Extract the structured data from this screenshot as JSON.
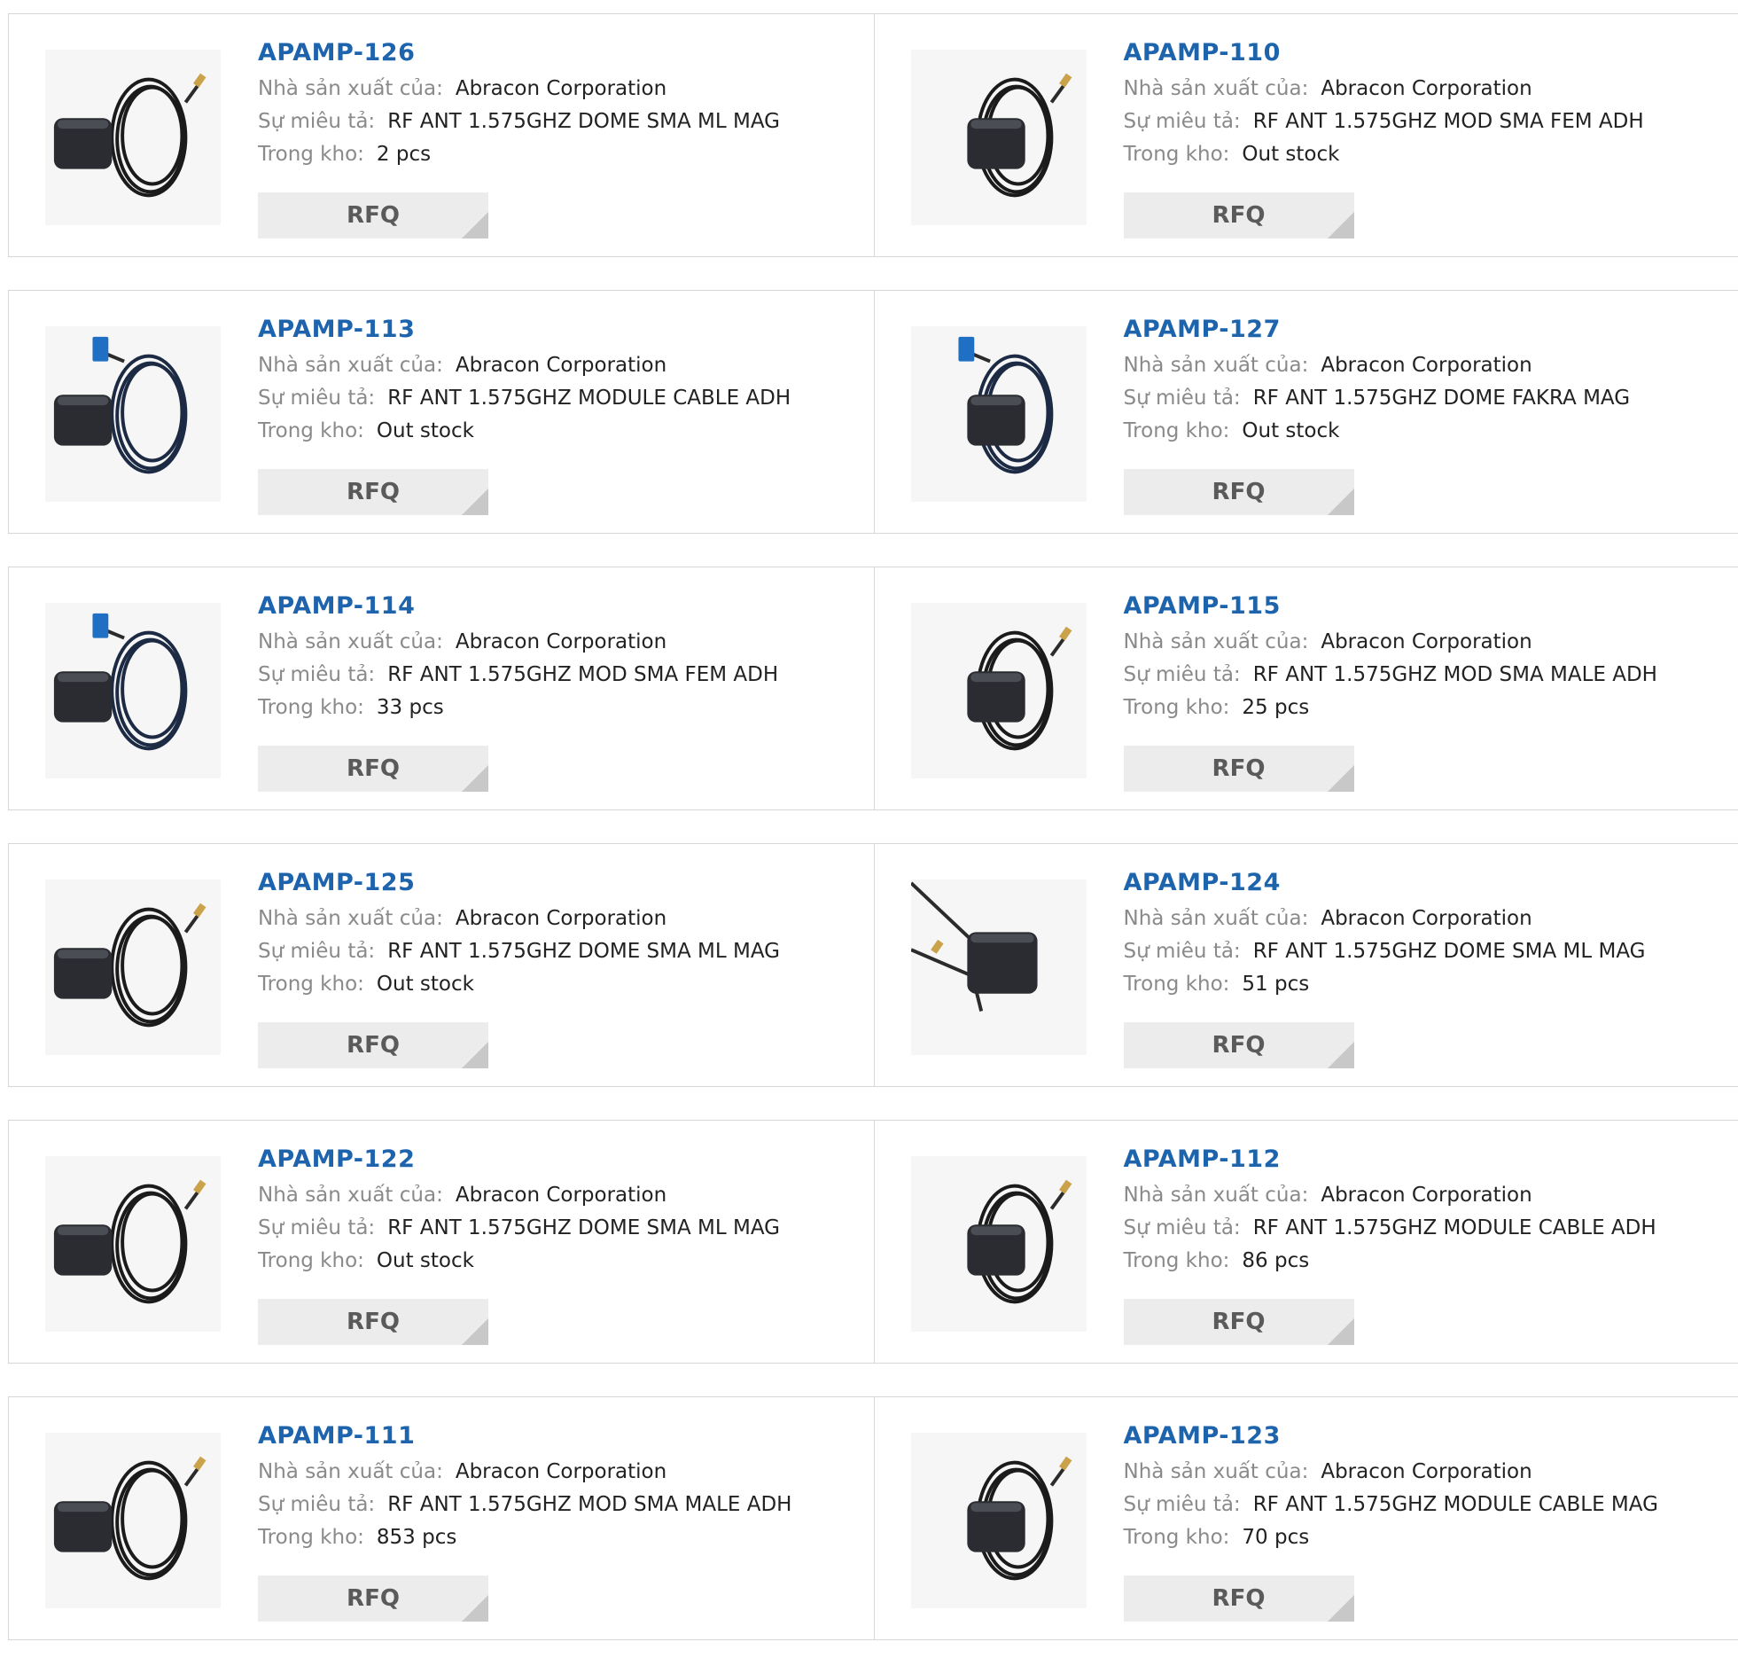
{
  "labels": {
    "manufacturer": "Nhà sản xuất của:",
    "description": "Sự miêu tả:",
    "stock": "Trong kho:",
    "rfq": "RFQ"
  },
  "colors": {
    "part_link": "#1e64ad",
    "label_gray": "#8a8a8a",
    "button_bg": "#ececec"
  },
  "products": [
    {
      "part": "APAMP-126",
      "manufacturer": "Abracon Corporation",
      "description": "RF ANT 1.575GHZ DOME SMA ML MAG",
      "stock": "2 pcs",
      "image_icon": "gps-antenna-coiled-cable-icon"
    },
    {
      "part": "APAMP-110",
      "manufacturer": "Abracon Corporation",
      "description": "RF ANT 1.575GHZ MOD SMA FEM ADH",
      "stock": "Out stock",
      "image_icon": "gps-antenna-coiled-cable-icon"
    },
    {
      "part": "APAMP-113",
      "manufacturer": "Abracon Corporation",
      "description": "RF ANT 1.575GHZ MODULE CABLE ADH",
      "stock": "Out stock",
      "image_icon": "gps-antenna-fakra-connector-icon"
    },
    {
      "part": "APAMP-127",
      "manufacturer": "Abracon Corporation",
      "description": "RF ANT 1.575GHZ DOME FAKRA MAG",
      "stock": "Out stock",
      "image_icon": "gps-antenna-fakra-connector-icon"
    },
    {
      "part": "APAMP-114",
      "manufacturer": "Abracon Corporation",
      "description": "RF ANT 1.575GHZ MOD SMA FEM ADH",
      "stock": "33 pcs",
      "image_icon": "gps-antenna-fakra-connector-icon"
    },
    {
      "part": "APAMP-115",
      "manufacturer": "Abracon Corporation",
      "description": "RF ANT 1.575GHZ MOD SMA MALE ADH",
      "stock": "25 pcs",
      "image_icon": "gps-antenna-coiled-cable-icon"
    },
    {
      "part": "APAMP-125",
      "manufacturer": "Abracon Corporation",
      "description": "RF ANT 1.575GHZ DOME SMA ML MAG",
      "stock": "Out stock",
      "image_icon": "gps-antenna-coiled-cable-icon"
    },
    {
      "part": "APAMP-124",
      "manufacturer": "Abracon Corporation",
      "description": "RF ANT 1.575GHZ DOME SMA ML MAG",
      "stock": "51 pcs",
      "image_icon": "gps-antenna-sma-connector-icon"
    },
    {
      "part": "APAMP-122",
      "manufacturer": "Abracon Corporation",
      "description": "RF ANT 1.575GHZ DOME SMA ML MAG",
      "stock": "Out stock",
      "image_icon": "gps-antenna-coiled-cable-icon"
    },
    {
      "part": "APAMP-112",
      "manufacturer": "Abracon Corporation",
      "description": "RF ANT 1.575GHZ MODULE CABLE ADH",
      "stock": "86 pcs",
      "image_icon": "gps-antenna-coiled-cable-icon"
    },
    {
      "part": "APAMP-111",
      "manufacturer": "Abracon Corporation",
      "description": "RF ANT 1.575GHZ MOD SMA MALE ADH",
      "stock": "853 pcs",
      "image_icon": "gps-antenna-coiled-cable-icon"
    },
    {
      "part": "APAMP-123",
      "manufacturer": "Abracon Corporation",
      "description": "RF ANT 1.575GHZ MODULE CABLE MAG",
      "stock": "70 pcs",
      "image_icon": "gps-antenna-coiled-cable-icon"
    }
  ]
}
